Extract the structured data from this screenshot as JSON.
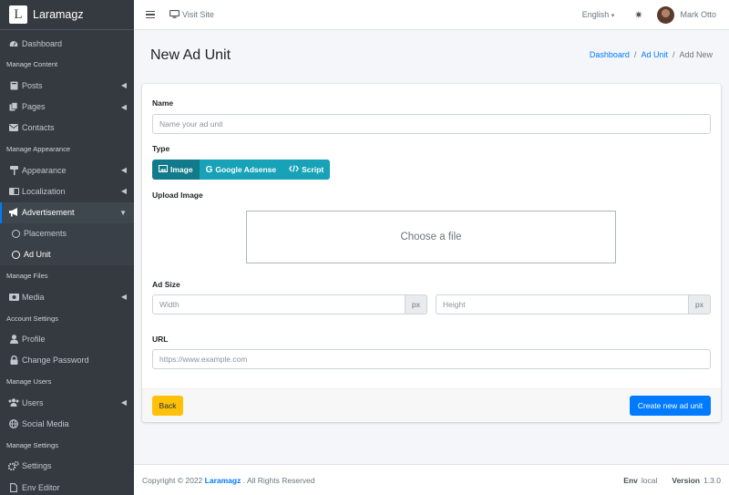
{
  "brand": {
    "logo_letter": "L",
    "name": "Laramagz"
  },
  "sidebar": {
    "dashboard": "Dashboard",
    "header_content": "Manage Content",
    "posts": "Posts",
    "pages": "Pages",
    "contacts": "Contacts",
    "header_appearance": "Manage Appearance",
    "appearance": "Appearance",
    "localization": "Localization",
    "advertisement": "Advertisement",
    "placements": "Placements",
    "ad_unit": "Ad Unit",
    "header_files": "Manage Files",
    "media": "Media",
    "header_account": "Account Settings",
    "profile": "Profile",
    "change_password": "Change Password",
    "header_users": "Manage Users",
    "users": "Users",
    "social_media": "Social Media",
    "header_settings": "Manage Settings",
    "settings": "Settings",
    "env_editor": "Env Editor"
  },
  "topbar": {
    "visit_site": "Visit Site",
    "language": "English",
    "user_name": "Mark Otto"
  },
  "page": {
    "title": "New Ad Unit"
  },
  "breadcrumb": {
    "dashboard": "Dashboard",
    "sep1": "/",
    "ad_unit": "Ad Unit",
    "sep2": "/",
    "current": "Add New"
  },
  "form": {
    "name_label": "Name",
    "name_placeholder": "Name your ad unit",
    "type_label": "Type",
    "type_image": "Image",
    "type_adsense": "Google Adsense",
    "type_script": "Script",
    "upload_label": "Upload Image",
    "dropzone_text": "Choose a file",
    "size_label": "Ad Size",
    "width_placeholder": "Width",
    "height_placeholder": "Height",
    "unit": "px",
    "url_label": "URL",
    "url_placeholder": "https://www.example.com",
    "back": "Back",
    "create": "Create new ad unit"
  },
  "footer": {
    "copyright": "Copyright © 2022",
    "brand": "Laramagz",
    "rights": ". All Rights Reserved",
    "env_label": "Env",
    "env_value": "local",
    "version_label": "Version",
    "version_value": "1.3.0"
  },
  "colors": {
    "sidebar": "#343a40",
    "primary": "#007bff",
    "info": "#17a2b8",
    "warning": "#ffc107"
  }
}
